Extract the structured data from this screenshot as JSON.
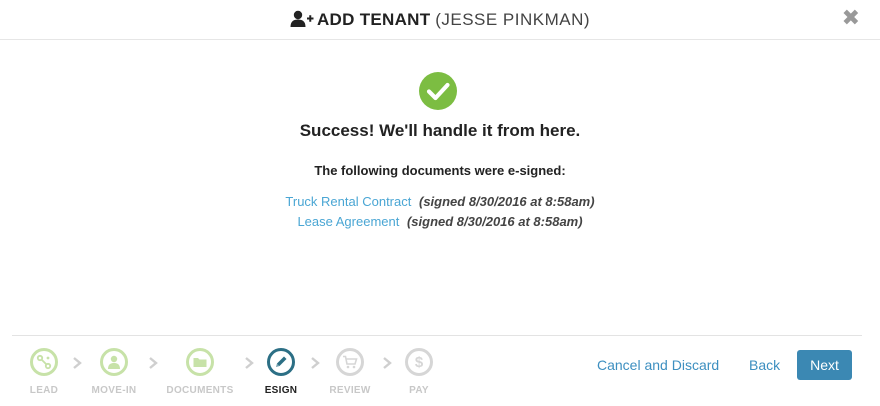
{
  "header": {
    "title": "ADD TENANT",
    "subtitle": "(JESSE PINKMAN)",
    "icon": "add-user-icon",
    "close_icon": "close-icon"
  },
  "status": {
    "icon": "check-circle-icon",
    "success_color": "#7cbd42",
    "message": "Success! We'll handle it from here."
  },
  "documents": {
    "heading": "The following documents were e-signed:",
    "items": [
      {
        "name": "Truck Rental Contract",
        "signed": "(signed 8/30/2016 at 8:58am)"
      },
      {
        "name": "Lease Agreement",
        "signed": "(signed 8/30/2016 at 8:58am)"
      }
    ]
  },
  "steps": [
    {
      "label": "LEAD",
      "icon": "route-icon",
      "state": "done"
    },
    {
      "label": "MOVE-IN",
      "icon": "person-icon",
      "state": "done"
    },
    {
      "label": "DOCUMENTS",
      "icon": "folder-icon",
      "state": "done"
    },
    {
      "label": "ESIGN",
      "icon": "pencil-icon",
      "state": "active"
    },
    {
      "label": "REVIEW",
      "icon": "cart-icon",
      "state": "todo"
    },
    {
      "label": "PAY",
      "icon": "dollar-icon",
      "state": "todo"
    }
  ],
  "actions": {
    "cancel_label": "Cancel and Discard",
    "back_label": "Back",
    "next_label": "Next"
  },
  "colors": {
    "accent": "#3b88b3",
    "link": "#4aa6d4",
    "active_step": "#2c6f85",
    "done_step": "#c7e2a8"
  }
}
